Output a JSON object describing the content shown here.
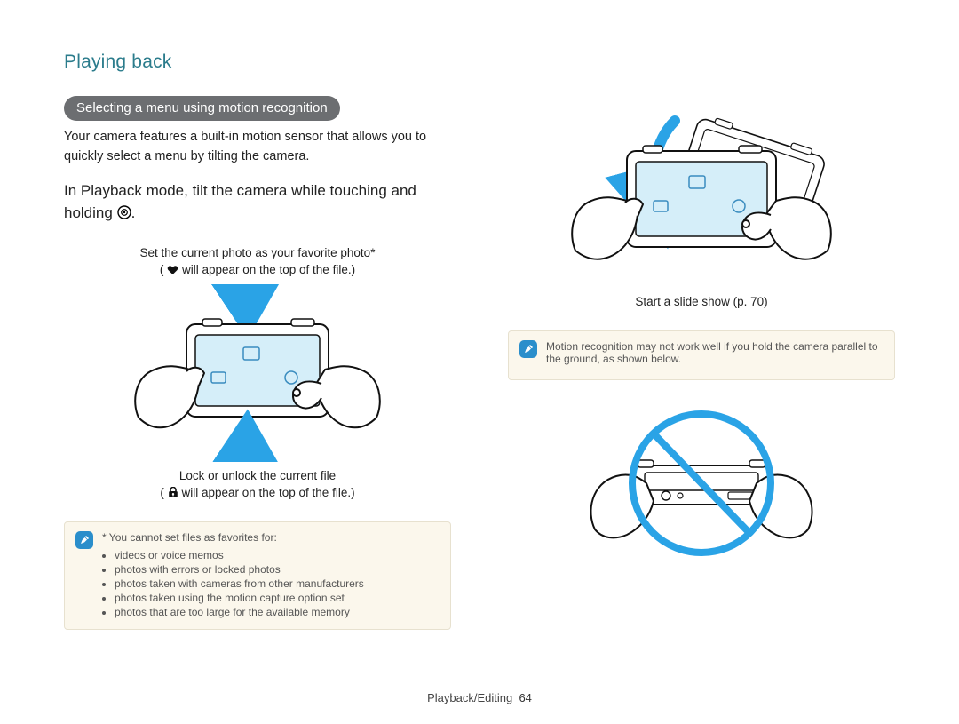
{
  "header": {
    "section_title": "Playing back"
  },
  "pill": {
    "label": "Selecting a menu using motion recognition"
  },
  "intro": {
    "lead": "Your camera features a built-in motion sensor that allows you to quickly select a menu by tilting the camera.",
    "instruction_pre": "In Playback mode, tilt the camera while touching and holding ",
    "instruction_post": "."
  },
  "figure_favorite": {
    "caption_top_line1": "Set the current photo as your favorite photo*",
    "caption_top_line2_pre": "(",
    "caption_top_line2_post": " will appear on the top of the file.)"
  },
  "figure_lock": {
    "caption_line1": "Lock or unlock the current file",
    "caption_line2_pre": "(",
    "caption_line2_post": " will appear on the top of the file.)"
  },
  "figure_slideshow": {
    "caption": "Start a slide show (p. 70)"
  },
  "note_left": {
    "lead": "* You cannot set files as favorites for:",
    "items": [
      "videos or voice memos",
      "photos with errors or locked photos",
      "photos taken with cameras from other manufacturers",
      "photos taken using the motion capture option set",
      "photos that are too large for the available memory"
    ]
  },
  "note_right": {
    "text": "Motion recognition may not work well if you hold the camera parallel to the ground, as shown below."
  },
  "footer": {
    "breadcrumb": "Playback/Editing",
    "page_number": "64"
  },
  "icons": {
    "target": "target-icon",
    "heart": "heart-icon",
    "lock": "lock-icon",
    "note_pen": "note-pen-icon"
  }
}
